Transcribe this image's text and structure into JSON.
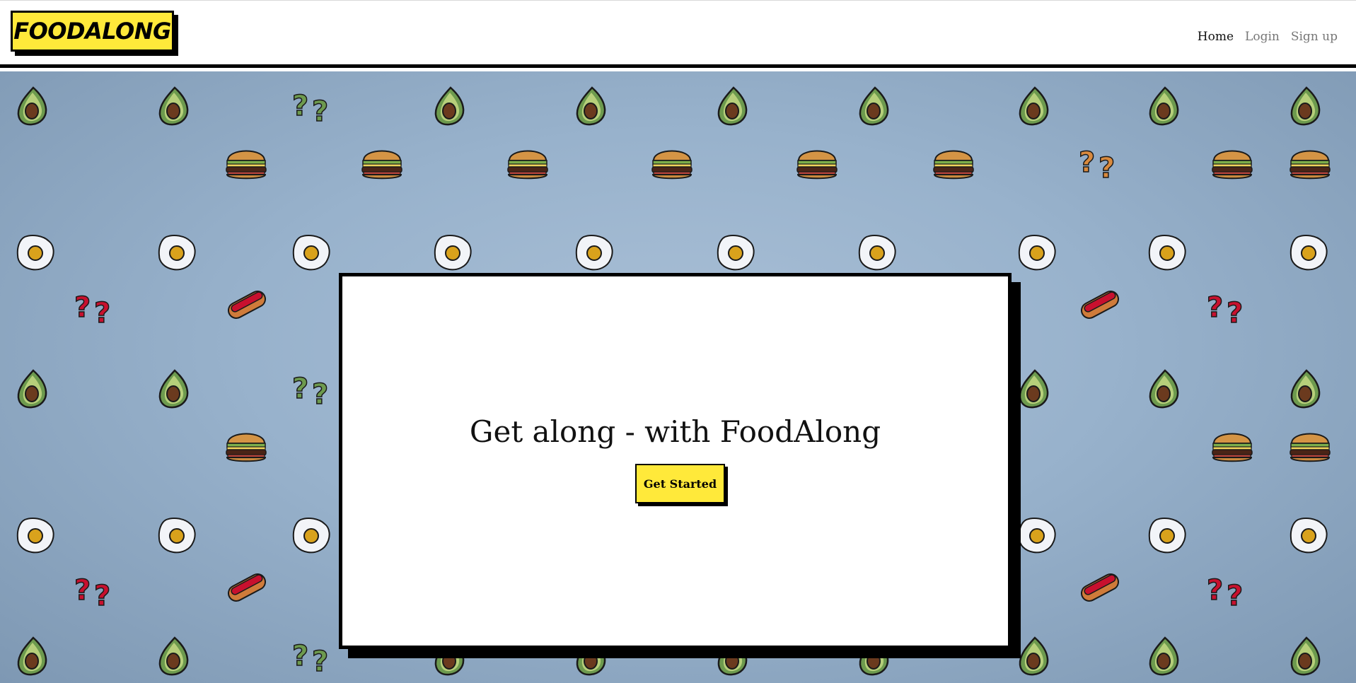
{
  "navbar": {
    "logo_text": "FOODALONG",
    "links": [
      {
        "label": "Home",
        "active": true
      },
      {
        "label": "Login",
        "active": false
      },
      {
        "label": "Sign up",
        "active": false
      }
    ]
  },
  "hero": {
    "heading": "Get along - with FoodAlong",
    "cta_label": "Get Started"
  },
  "background": {
    "pattern_icons": [
      "avocado-icon",
      "burger-icon",
      "fried-egg-icon",
      "hotdog-icon",
      "question-marks-icon"
    ]
  },
  "colors": {
    "brand_yellow": "#ffe93a",
    "avocado_green": "#6d9a4e",
    "question_red": "#c8102e",
    "question_green": "#6d9a4e",
    "question_orange": "#d98a3e"
  }
}
